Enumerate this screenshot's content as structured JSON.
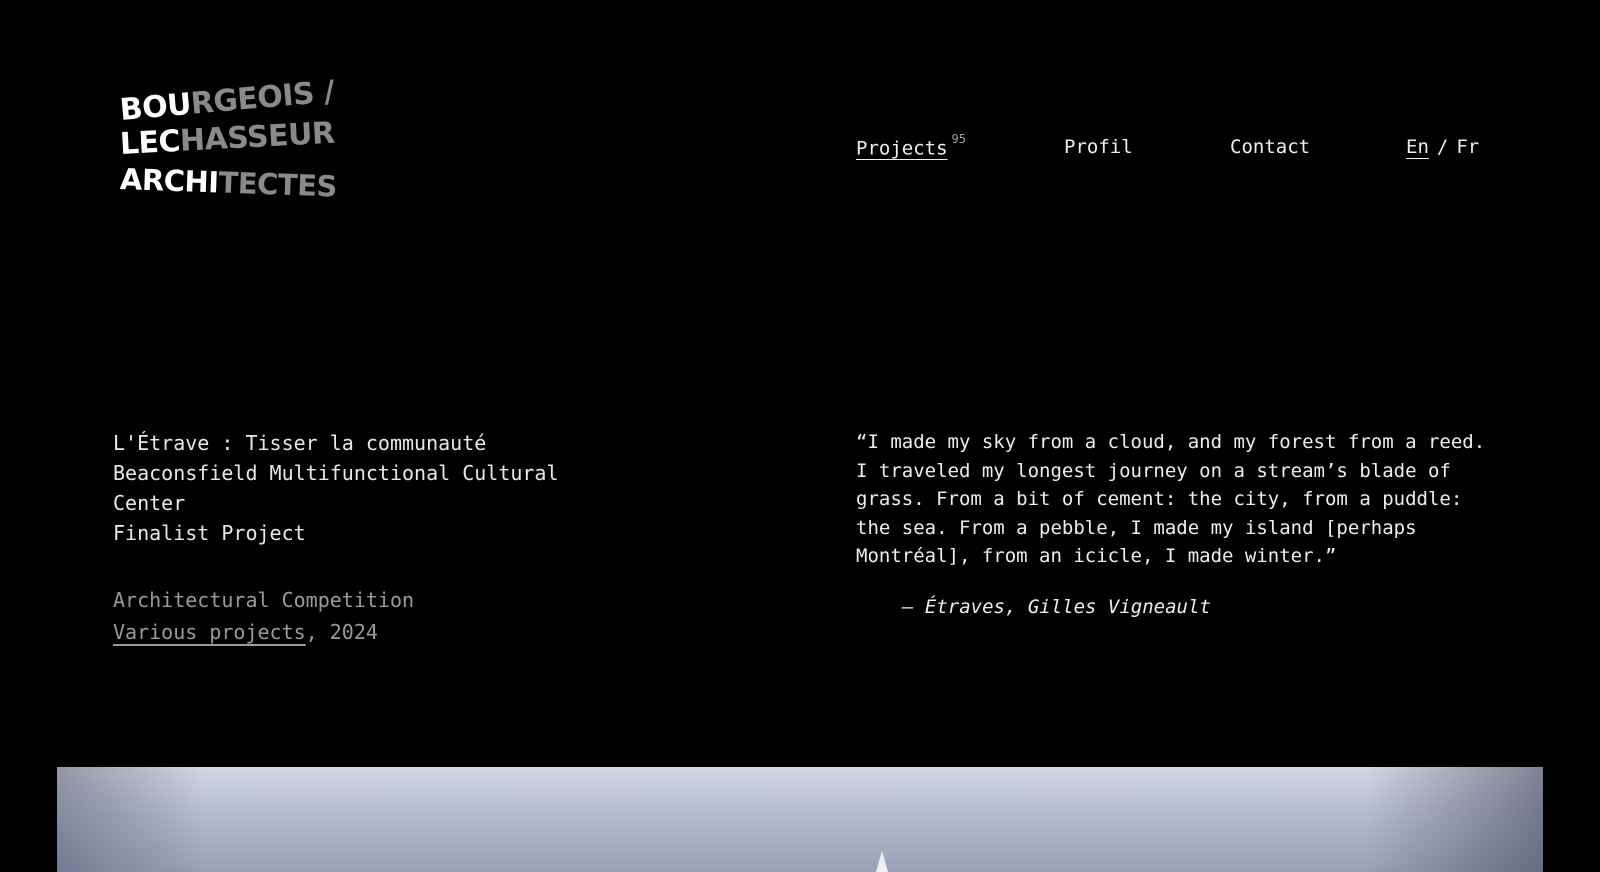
{
  "logo": {
    "line1_white": "BOU",
    "line1_grey": "RGEOIS /",
    "line2_white": "LEC",
    "line2_grey": "HASSEUR",
    "line3_white": "ARCHI",
    "line3_grey": "TECTES"
  },
  "nav": {
    "projects_label": "Projects",
    "projects_count": "95",
    "profil_label": "Profil",
    "contact_label": "Contact",
    "lang_en": "En",
    "lang_sep": "/",
    "lang_fr": "Fr"
  },
  "project": {
    "title_line1": "L'Étrave : Tisser la communauté",
    "title_line2": "Beaconsfield Multifunctional Cultural Center",
    "status": "Finalist Project",
    "category": "Architectural Competition",
    "link_label": "Various projects",
    "year_suffix": ", 2024"
  },
  "quote": {
    "text": "“I made my sky from a cloud, and my forest from a reed. I traveled my longest journey on a stream’s blade of grass. From a bit of cement: the city, from a puddle: the sea. From a pebble, I made my island [perhaps Montréal], from an icicle, I made winter.”",
    "author": "— Étraves, Gilles Vigneault"
  },
  "colors": {
    "background": "#000000",
    "text": "#f0f0f0",
    "muted": "#9a9a9a"
  }
}
